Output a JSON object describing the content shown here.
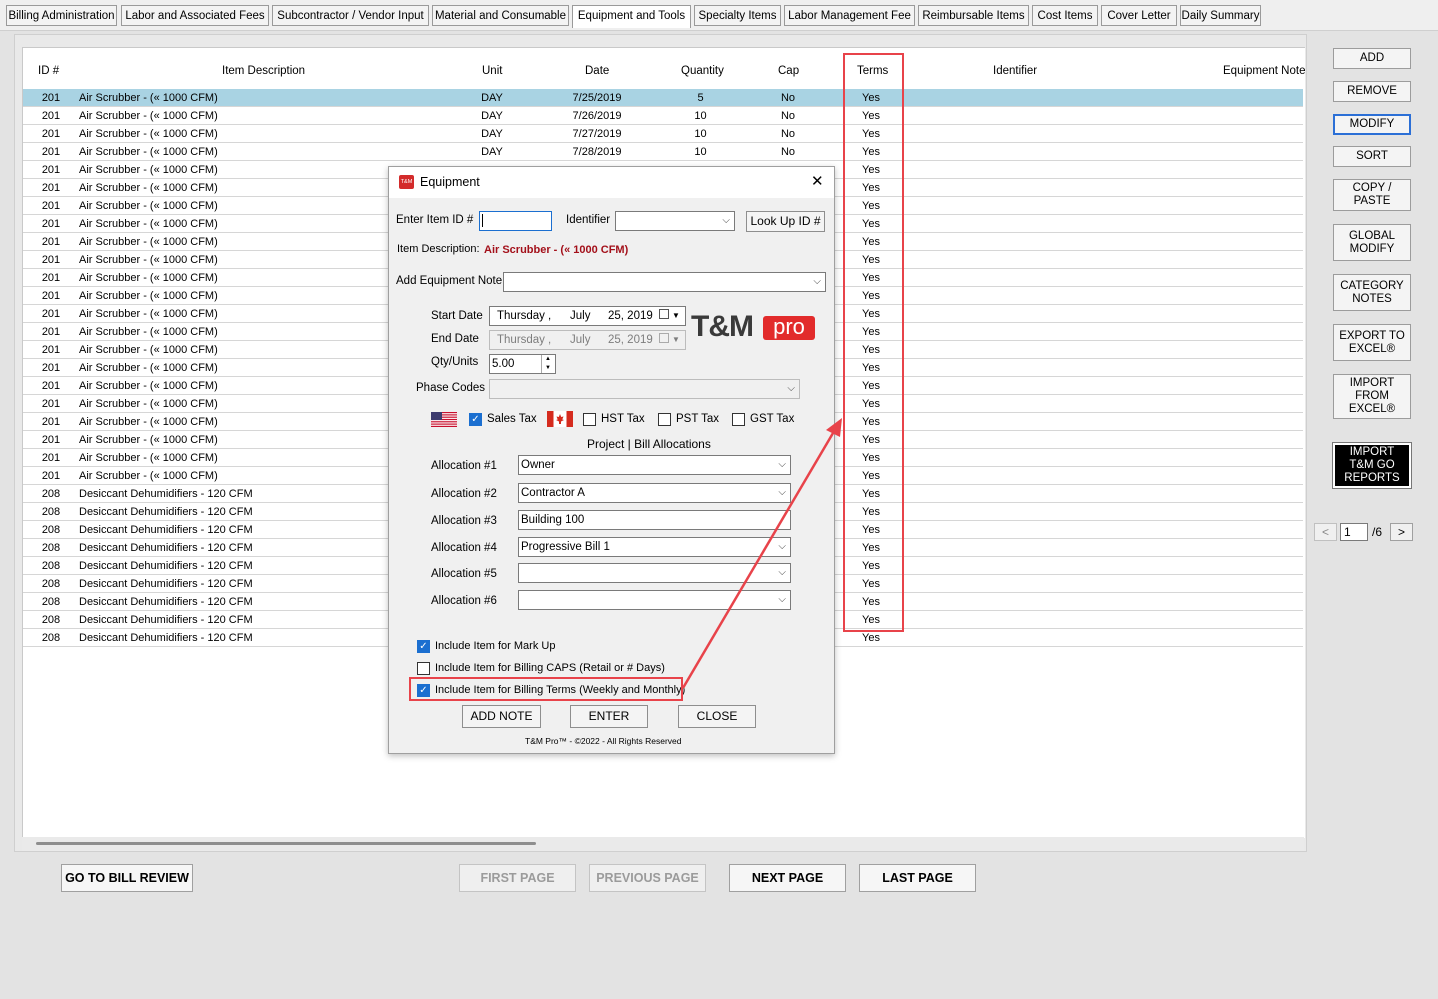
{
  "tabs": [
    "Billing Administration",
    "Labor and Associated Fees",
    "Subcontractor / Vendor Input",
    "Material and Consumable",
    "Equipment and Tools",
    "Specialty Items",
    "Labor Management Fee",
    "Reimbursable Items",
    "Cost Items",
    "Cover Letter",
    "Daily Summary"
  ],
  "active_tab": "Equipment and Tools",
  "grid": {
    "headers": {
      "id": "ID #",
      "desc": "Item Description",
      "unit": "Unit",
      "date": "Date",
      "qty": "Quantity",
      "cap": "Cap",
      "terms": "Terms",
      "ident": "Identifier",
      "note": "Equipment Note"
    },
    "rows": [
      {
        "id": "201",
        "desc": "Air Scrubber - (« 1000 CFM)",
        "unit": "DAY",
        "date": "7/25/2019",
        "qty": "5",
        "cap": "No",
        "terms": "Yes"
      },
      {
        "id": "201",
        "desc": "Air Scrubber - (« 1000 CFM)",
        "unit": "DAY",
        "date": "7/26/2019",
        "qty": "10",
        "cap": "No",
        "terms": "Yes"
      },
      {
        "id": "201",
        "desc": "Air Scrubber - (« 1000 CFM)",
        "unit": "DAY",
        "date": "7/27/2019",
        "qty": "10",
        "cap": "No",
        "terms": "Yes"
      },
      {
        "id": "201",
        "desc": "Air Scrubber - (« 1000 CFM)",
        "unit": "DAY",
        "date": "7/28/2019",
        "qty": "10",
        "cap": "No",
        "terms": "Yes"
      },
      {
        "id": "201",
        "desc": "Air Scrubber - (« 1000 CFM)",
        "unit": "",
        "date": "",
        "qty": "",
        "cap": "",
        "terms": "Yes"
      },
      {
        "id": "201",
        "desc": "Air Scrubber - (« 1000 CFM)",
        "unit": "",
        "date": "",
        "qty": "",
        "cap": "",
        "terms": "Yes"
      },
      {
        "id": "201",
        "desc": "Air Scrubber - (« 1000 CFM)",
        "unit": "",
        "date": "",
        "qty": "",
        "cap": "",
        "terms": "Yes"
      },
      {
        "id": "201",
        "desc": "Air Scrubber - (« 1000 CFM)",
        "unit": "",
        "date": "",
        "qty": "",
        "cap": "",
        "terms": "Yes"
      },
      {
        "id": "201",
        "desc": "Air Scrubber - (« 1000 CFM)",
        "unit": "",
        "date": "",
        "qty": "",
        "cap": "",
        "terms": "Yes"
      },
      {
        "id": "201",
        "desc": "Air Scrubber - (« 1000 CFM)",
        "unit": "",
        "date": "",
        "qty": "",
        "cap": "",
        "terms": "Yes"
      },
      {
        "id": "201",
        "desc": "Air Scrubber - (« 1000 CFM)",
        "unit": "",
        "date": "",
        "qty": "",
        "cap": "",
        "terms": "Yes"
      },
      {
        "id": "201",
        "desc": "Air Scrubber - (« 1000 CFM)",
        "unit": "",
        "date": "",
        "qty": "",
        "cap": "",
        "terms": "Yes"
      },
      {
        "id": "201",
        "desc": "Air Scrubber - (« 1000 CFM)",
        "unit": "",
        "date": "",
        "qty": "",
        "cap": "",
        "terms": "Yes"
      },
      {
        "id": "201",
        "desc": "Air Scrubber - (« 1000 CFM)",
        "unit": "",
        "date": "",
        "qty": "",
        "cap": "",
        "terms": "Yes"
      },
      {
        "id": "201",
        "desc": "Air Scrubber - (« 1000 CFM)",
        "unit": "",
        "date": "",
        "qty": "",
        "cap": "",
        "terms": "Yes"
      },
      {
        "id": "201",
        "desc": "Air Scrubber - (« 1000 CFM)",
        "unit": "",
        "date": "",
        "qty": "",
        "cap": "",
        "terms": "Yes"
      },
      {
        "id": "201",
        "desc": "Air Scrubber - (« 1000 CFM)",
        "unit": "",
        "date": "",
        "qty": "",
        "cap": "",
        "terms": "Yes"
      },
      {
        "id": "201",
        "desc": "Air Scrubber - (« 1000 CFM)",
        "unit": "",
        "date": "",
        "qty": "",
        "cap": "",
        "terms": "Yes"
      },
      {
        "id": "201",
        "desc": "Air Scrubber - (« 1000 CFM)",
        "unit": "",
        "date": "",
        "qty": "",
        "cap": "",
        "terms": "Yes"
      },
      {
        "id": "201",
        "desc": "Air Scrubber - (« 1000 CFM)",
        "unit": "",
        "date": "",
        "qty": "",
        "cap": "",
        "terms": "Yes"
      },
      {
        "id": "201",
        "desc": "Air Scrubber - (« 1000 CFM)",
        "unit": "",
        "date": "",
        "qty": "",
        "cap": "",
        "terms": "Yes"
      },
      {
        "id": "201",
        "desc": "Air Scrubber - (« 1000 CFM)",
        "unit": "",
        "date": "",
        "qty": "",
        "cap": "",
        "terms": "Yes"
      },
      {
        "id": "208",
        "desc": "Desiccant Dehumidifiers - 120 CFM",
        "unit": "",
        "date": "",
        "qty": "",
        "cap": "",
        "terms": "Yes"
      },
      {
        "id": "208",
        "desc": "Desiccant Dehumidifiers - 120 CFM",
        "unit": "",
        "date": "",
        "qty": "",
        "cap": "",
        "terms": "Yes"
      },
      {
        "id": "208",
        "desc": "Desiccant Dehumidifiers - 120 CFM",
        "unit": "",
        "date": "",
        "qty": "",
        "cap": "",
        "terms": "Yes"
      },
      {
        "id": "208",
        "desc": "Desiccant Dehumidifiers - 120 CFM",
        "unit": "",
        "date": "",
        "qty": "",
        "cap": "",
        "terms": "Yes"
      },
      {
        "id": "208",
        "desc": "Desiccant Dehumidifiers - 120 CFM",
        "unit": "",
        "date": "",
        "qty": "",
        "cap": "",
        "terms": "Yes"
      },
      {
        "id": "208",
        "desc": "Desiccant Dehumidifiers - 120 CFM",
        "unit": "",
        "date": "",
        "qty": "",
        "cap": "",
        "terms": "Yes"
      },
      {
        "id": "208",
        "desc": "Desiccant Dehumidifiers - 120 CFM",
        "unit": "",
        "date": "",
        "qty": "",
        "cap": "",
        "terms": "Yes"
      },
      {
        "id": "208",
        "desc": "Desiccant Dehumidifiers - 120 CFM",
        "unit": "",
        "date": "",
        "qty": "",
        "cap": "",
        "terms": "Yes"
      },
      {
        "id": "208",
        "desc": "Desiccant Dehumidifiers - 120 CFM",
        "unit": "",
        "date": "",
        "qty": "",
        "cap": "",
        "terms": "Yes"
      }
    ]
  },
  "right_buttons": {
    "add": "ADD",
    "remove": "REMOVE",
    "modify": "MODIFY",
    "sort": "SORT",
    "copy": "COPY / PASTE",
    "global": "GLOBAL MODIFY",
    "category": "CATEGORY NOTES",
    "export": "EXPORT TO EXCEL®",
    "import_excel": "IMPORT FROM EXCEL®",
    "import_go": "IMPORT T&M GO REPORTS"
  },
  "pager": {
    "prev": "<",
    "page": "1",
    "total": "/6",
    "next": ">"
  },
  "bottom": {
    "bill_review": "GO TO BILL REVIEW",
    "first": "FIRST PAGE",
    "previous": "PREVIOUS PAGE",
    "next": "NEXT PAGE",
    "last": "LAST PAGE"
  },
  "dialog": {
    "title": "Equipment",
    "app_icon": "T&M",
    "close": "✕",
    "enter_item_label": "Enter Item ID #",
    "enter_item_value": "",
    "identifier_label": "Identifier",
    "identifier_value": "",
    "lookup": "Look Up ID #",
    "desc_label": "Item Description:",
    "desc_value": "Air Scrubber - (« 1000 CFM)",
    "note_label": "Add Equipment Note",
    "note_value": "",
    "start_label": "Start Date",
    "start_day": "Thursday",
    "start_month": "July",
    "start_daynum": "25, 2019",
    "end_label": "End Date",
    "end_day": "Thursday",
    "end_month": "July",
    "end_daynum": "25, 2019",
    "qty_label": "Qty/Units",
    "qty_value": "5.00",
    "phase_label": "Phase Codes",
    "phase_value": "",
    "logo_a": "T&M",
    "logo_b": "pro",
    "sales_tax": "Sales Tax",
    "hst": "HST Tax",
    "pst": "PST Tax",
    "gst": "GST Tax",
    "alloc_title": "Project | Bill Allocations",
    "allocs": [
      {
        "label": "Allocation #1",
        "value": "Owner",
        "dropdown": true
      },
      {
        "label": "Allocation #2",
        "value": "Contractor A",
        "dropdown": true
      },
      {
        "label": "Allocation #3",
        "value": "Building 100",
        "dropdown": false
      },
      {
        "label": "Allocation #4",
        "value": "Progressive Bill 1",
        "dropdown": true
      },
      {
        "label": "Allocation #5",
        "value": "",
        "dropdown": true
      },
      {
        "label": "Allocation #6",
        "value": "",
        "dropdown": true
      }
    ],
    "markup": "Include Item for Mark Up",
    "caps": "Include Item for Billing CAPS (Retail or # Days)",
    "terms": "Include Item for Billing Terms (Weekly and Monthly)",
    "add_note": "ADD NOTE",
    "enter": "ENTER",
    "close_btn": "CLOSE",
    "copyright": "T&M Pro™ - ©2022 - All Rights Reserved"
  },
  "colors": {
    "highlight": "#e8434a",
    "selected_row": "#a9d3e3",
    "check": "#1b6fd0",
    "logo_red": "#e22b2b"
  }
}
